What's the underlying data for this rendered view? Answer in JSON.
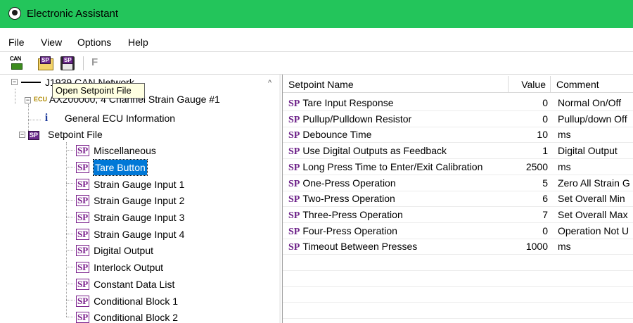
{
  "window": {
    "title": "Electronic Assistant"
  },
  "menu": [
    "File",
    "View",
    "Options",
    "Help"
  ],
  "toolbar": {
    "can_label": "CAN",
    "sp_label": "SP",
    "f_label": "F"
  },
  "tooltip": "Open Setpoint File",
  "tree": {
    "root_label": "J1939 CAN Network",
    "ecu_badge": "ECU",
    "ecu_label": "AX200000, 4 Channel Strain Gauge #1",
    "general_label": "General ECU Information",
    "setpoint_file_label": "Setpoint File",
    "items": [
      "Miscellaneous",
      "Tare Button",
      "Strain Gauge Input 1",
      "Strain Gauge Input 2",
      "Strain Gauge Input 3",
      "Strain Gauge Input 4",
      "Digital Output",
      "Interlock Output",
      "Constant Data List",
      "Conditional Block 1",
      "Conditional Block 2"
    ],
    "selected_index": 1
  },
  "table": {
    "columns": [
      "Setpoint Name",
      "Value",
      "Comment"
    ],
    "sp_prefix": "SP",
    "rows": [
      {
        "name": "Tare Input Response",
        "value": "0",
        "comment": "Normal On/Off"
      },
      {
        "name": "Pullup/Pulldown Resistor",
        "value": "0",
        "comment": "Pullup/down Off"
      },
      {
        "name": "Debounce Time",
        "value": "10",
        "comment": "ms"
      },
      {
        "name": "Use Digital Outputs as Feedback",
        "value": "1",
        "comment": "Digital Output"
      },
      {
        "name": "Long Press Time to Enter/Exit Calibration",
        "value": "2500",
        "comment": "ms"
      },
      {
        "name": "One-Press Operation",
        "value": "5",
        "comment": "Zero All Strain G"
      },
      {
        "name": "Two-Press Operation",
        "value": "6",
        "comment": "Set Overall Min"
      },
      {
        "name": "Three-Press Operation",
        "value": "7",
        "comment": "Set Overall Max"
      },
      {
        "name": "Four-Press Operation",
        "value": "0",
        "comment": "Operation Not U"
      },
      {
        "name": "Timeout Between Presses",
        "value": "1000",
        "comment": "ms"
      }
    ]
  }
}
